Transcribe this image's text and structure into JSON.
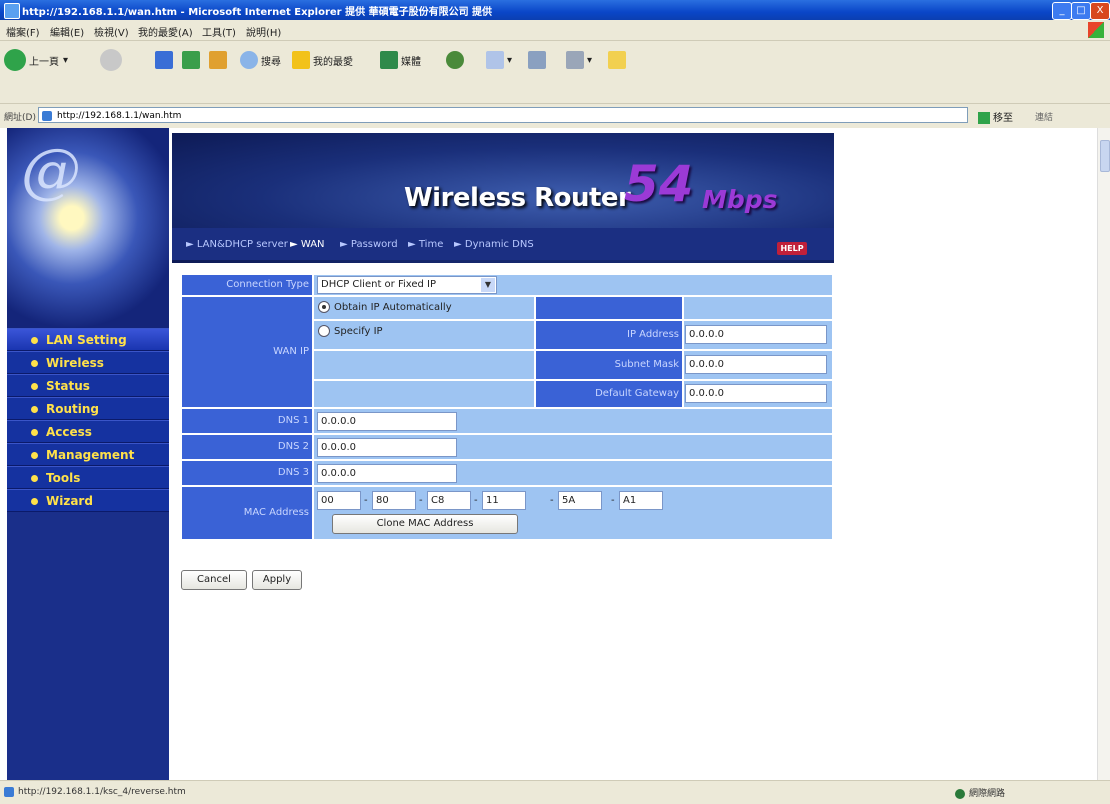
{
  "window": {
    "title": "http://192.168.1.1/wan.htm - Microsoft Internet Explorer 提供 華碩電子股份有限公司 提供",
    "controls": [
      "_",
      "□",
      "X"
    ]
  },
  "menu": [
    "檔案(F)",
    "編輯(E)",
    "檢視(V)",
    "我的最愛(A)",
    "工具(T)",
    "說明(H)"
  ],
  "toolbar": {
    "back": "上一頁",
    "search": "搜尋",
    "favorites": "我的最愛",
    "media": "媒體"
  },
  "address": {
    "label": "網址(D)",
    "url": "http://192.168.1.1/wan.htm",
    "go": "移至",
    "links": "連結"
  },
  "sidebar": {
    "items": [
      {
        "label": "LAN Setting"
      },
      {
        "label": "Wireless"
      },
      {
        "label": "Status"
      },
      {
        "label": "Routing"
      },
      {
        "label": "Access"
      },
      {
        "label": "Management"
      },
      {
        "label": "Tools"
      },
      {
        "label": "Wizard"
      }
    ]
  },
  "header": {
    "brand": "Wireless Router",
    "speed": "54",
    "unit": "Mbps",
    "links": [
      "LAN&DHCP server",
      "WAN",
      "Password",
      "Time",
      "Dynamic DNS"
    ],
    "help": "HELP"
  },
  "form": {
    "connection_type_label": "Connection Type",
    "connection_type_value": "DHCP Client or Fixed IP",
    "wan_ip_label": "WAN IP",
    "obtain_ip": "Obtain IP Automatically",
    "specify_ip": "Specify IP",
    "ip_address_label": "IP Address",
    "ip_address": "0.0.0.0",
    "subnet_mask_label": "Subnet Mask",
    "subnet_mask": "0.0.0.0",
    "gateway_label": "Default Gateway",
    "gateway": "0.0.0.0",
    "dns1_label": "DNS 1",
    "dns1": "0.0.0.0",
    "dns2_label": "DNS 2",
    "dns2": "0.0.0.0",
    "dns3_label": "DNS 3",
    "dns3": "0.0.0.0",
    "mac_label": "MAC Address",
    "mac": [
      "00",
      "80",
      "C8",
      "11",
      "5A",
      "A1"
    ],
    "clone_mac": "Clone MAC Address",
    "cancel": "Cancel",
    "apply": "Apply"
  },
  "status": {
    "url": "http://192.168.1.1/ksc_4/reverse.htm",
    "zone": "網際網路"
  }
}
